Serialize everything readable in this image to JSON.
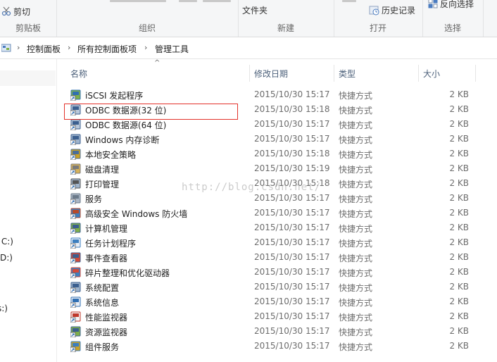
{
  "ribbon": {
    "clipboard": {
      "cut_label": "剪切",
      "group_label": "剪贴板"
    },
    "organize": {
      "group_label": "组织"
    },
    "new": {
      "folder_label": "文件夹",
      "group_label": "新建"
    },
    "open": {
      "history_label": "历史记录",
      "group_label": "打开"
    },
    "select": {
      "invert_label": "反向选择",
      "group_label": "选择"
    }
  },
  "address": {
    "crumbs": [
      "控制面板",
      "所有控制面板项",
      "管理工具"
    ]
  },
  "nav": {
    "items": [
      ": C:)",
      "D:)",
      "s:)"
    ]
  },
  "columns": {
    "name": "名称",
    "date": "修改日期",
    "type": "类型",
    "size": "大小"
  },
  "files": [
    {
      "name": "iSCSI 发起程序",
      "date": "2015/10/30 15:17",
      "type": "快捷方式",
      "size": "2 KB",
      "icon": "iscsi-icon"
    },
    {
      "name": "ODBC 数据源(32 位)",
      "date": "2015/10/30 15:18",
      "type": "快捷方式",
      "size": "2 KB",
      "icon": "odbc-icon"
    },
    {
      "name": "ODBC 数据源(64 位)",
      "date": "2015/10/30 15:17",
      "type": "快捷方式",
      "size": "2 KB",
      "icon": "odbc-icon"
    },
    {
      "name": "Windows 内存诊断",
      "date": "2015/10/30 15:17",
      "type": "快捷方式",
      "size": "2 KB",
      "icon": "memory-diagnostic-icon"
    },
    {
      "name": "本地安全策略",
      "date": "2015/10/30 15:18",
      "type": "快捷方式",
      "size": "2 KB",
      "icon": "security-policy-icon"
    },
    {
      "name": "磁盘清理",
      "date": "2015/10/30 15:19",
      "type": "快捷方式",
      "size": "2 KB",
      "icon": "disk-cleanup-icon"
    },
    {
      "name": "打印管理",
      "date": "2015/10/30 15:18",
      "type": "快捷方式",
      "size": "2 KB",
      "icon": "print-management-icon"
    },
    {
      "name": "服务",
      "date": "2015/10/30 15:17",
      "type": "快捷方式",
      "size": "2 KB",
      "icon": "services-icon"
    },
    {
      "name": "高级安全 Windows 防火墙",
      "date": "2015/10/30 15:17",
      "type": "快捷方式",
      "size": "2 KB",
      "icon": "firewall-icon"
    },
    {
      "name": "计算机管理",
      "date": "2015/10/30 15:17",
      "type": "快捷方式",
      "size": "2 KB",
      "icon": "computer-management-icon"
    },
    {
      "name": "任务计划程序",
      "date": "2015/10/30 15:17",
      "type": "快捷方式",
      "size": "2 KB",
      "icon": "task-scheduler-icon"
    },
    {
      "name": "事件查看器",
      "date": "2015/10/30 15:17",
      "type": "快捷方式",
      "size": "2 KB",
      "icon": "event-viewer-icon"
    },
    {
      "name": "碎片整理和优化驱动器",
      "date": "2015/10/30 15:17",
      "type": "快捷方式",
      "size": "2 KB",
      "icon": "defrag-icon"
    },
    {
      "name": "系统配置",
      "date": "2015/10/30 15:17",
      "type": "快捷方式",
      "size": "2 KB",
      "icon": "system-config-icon"
    },
    {
      "name": "系统信息",
      "date": "2015/10/30 15:17",
      "type": "快捷方式",
      "size": "2 KB",
      "icon": "system-info-icon"
    },
    {
      "name": "性能监视器",
      "date": "2015/10/30 15:17",
      "type": "快捷方式",
      "size": "2 KB",
      "icon": "performance-monitor-icon"
    },
    {
      "name": "资源监视器",
      "date": "2015/10/30 15:17",
      "type": "快捷方式",
      "size": "2 KB",
      "icon": "resource-monitor-icon"
    },
    {
      "name": "组件服务",
      "date": "2015/10/30 15:17",
      "type": "快捷方式",
      "size": "2 KB",
      "icon": "component-services-icon"
    }
  ],
  "watermark": "http://blog.csdn.net/",
  "colors": {
    "highlight_border": "#e3322b",
    "header_text": "#4c607a",
    "accent_blue": "#2b6cb5"
  }
}
